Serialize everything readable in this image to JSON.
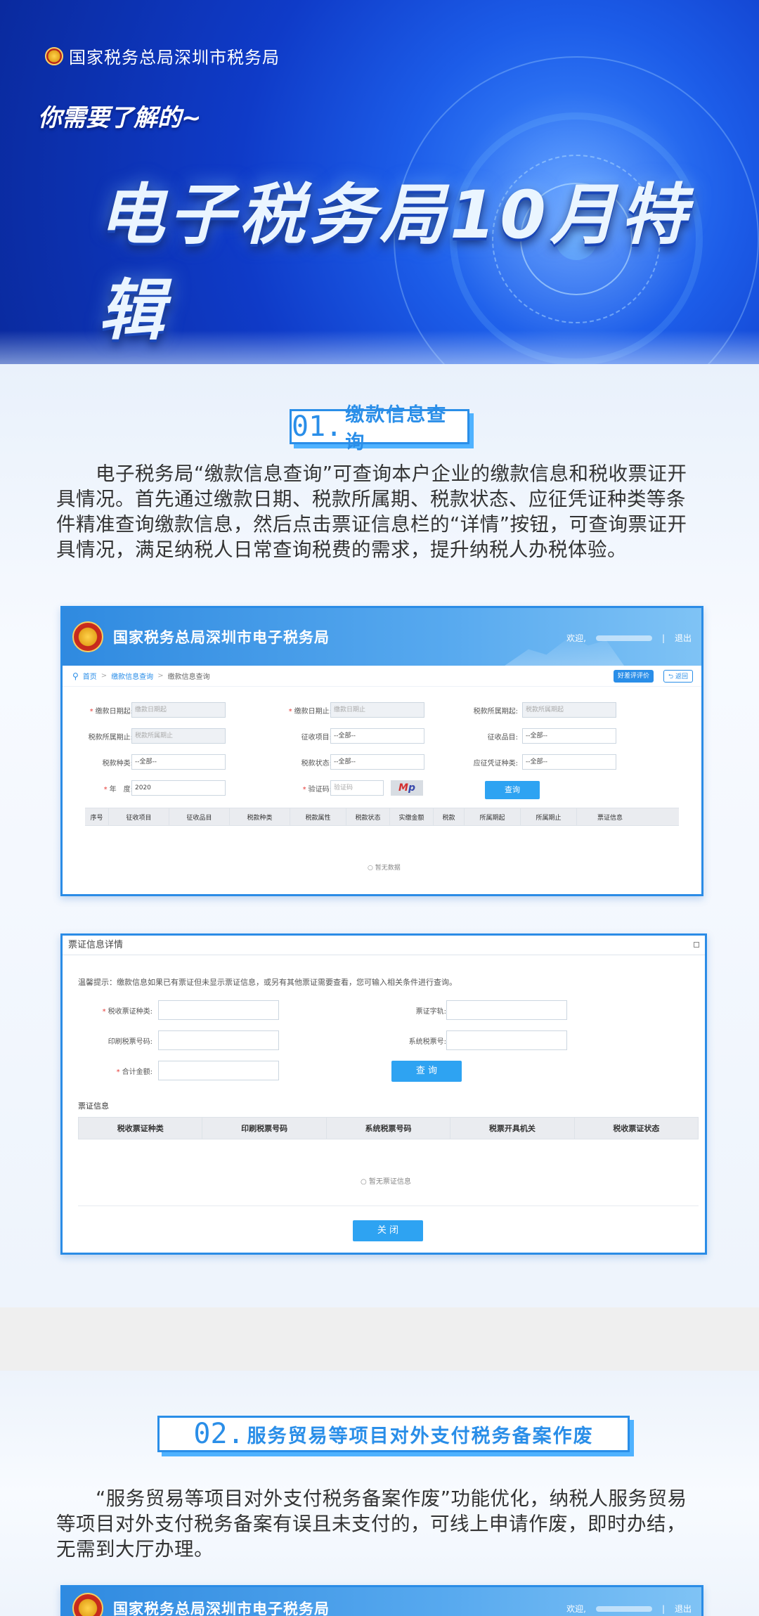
{
  "banner": {
    "org": "国家税务总局深圳市税务局",
    "subhead": "你需要了解的~",
    "title": "电子税务局10月特辑"
  },
  "section1": {
    "number": "01.",
    "heading": "缴款信息查询",
    "paragraph": "电子税务局“缴款信息查询”可查询本户企业的缴款信息和税收票证开具情况。首先通过缴款日期、税款所属期、税款状态、应征凭证种类等条件精准查询缴款信息，然后点击票证信息栏的“详情”按钮，可查询票证开具情况，满足纳税人日常查询税费的需求，提升纳税人办税体验。",
    "app": {
      "title": "国家税务总局深圳市电子税务局",
      "welcome": "欢迎,",
      "logout": "退出",
      "breadcrumb": [
        "首页",
        "缴款信息查询",
        "缴款信息查询"
      ],
      "eval_button": "好差评评价",
      "back_button": "返回",
      "form": {
        "pay_date_from_label": "缴款日期起:",
        "pay_date_from_ph": "缴款日期起",
        "pay_date_to_label": "缴款日期止:",
        "pay_date_to_ph": "缴款日期止",
        "tax_period_from_label": "税款所属期起:",
        "tax_period_from_ph": "税款所属期起",
        "tax_period_to_label": "税款所属期止:",
        "tax_period_to_ph": "税款所属期止",
        "levy_item_label": "征收项目:",
        "levy_item_value": "--全部--",
        "levy_product_label": "征收品目:",
        "levy_product_value": "--全部--",
        "tax_type_label": "税款种类:",
        "tax_type_value": "--全部--",
        "tax_status_label": "税款状态:",
        "tax_status_value": "--全部--",
        "voucher_type_label": "应征凭证种类:",
        "voucher_type_value": "--全部--",
        "year_label": "年　度:",
        "year_value": "2020",
        "captcha_label": "验证码:",
        "captcha_ph": "验证码",
        "captcha_a": "M",
        "captcha_b": "p",
        "query_button": "查询"
      },
      "table_headers": [
        "序号",
        "征收项目",
        "征收品目",
        "税款种类",
        "税款属性",
        "税款状态",
        "实缴金额",
        "税款",
        "所属期起",
        "所属期止",
        "票证信息"
      ],
      "no_data": "○ 暂无数据"
    },
    "modal": {
      "title": "票证信息详情",
      "tip": "温馨提示：缴款信息如果已有票证但未显示票证信息，或另有其他票证需要查看，您可输入相关条件进行查询。",
      "voucher_type_label": "税收票证种类:",
      "voucher_word_label": "票证字轨:",
      "print_no_label": "印刷税票号码:",
      "system_no_label": "系统税票号:",
      "total_label": "合计金额:",
      "query_button": "查 询",
      "ticket_info": "票证信息",
      "table_headers": [
        "税收票证种类",
        "印刷税票号码",
        "系统税票号码",
        "税票开具机关",
        "税收票证状态"
      ],
      "no_data": "○ 暂无票证信息",
      "close_button": "关 闭"
    }
  },
  "section2": {
    "number": "02.",
    "heading": "服务贸易等项目对外支付税务备案作废",
    "paragraph": "“服务贸易等项目对外支付税务备案作废”功能优化，纳税人服务贸易等项目对外支付税务备案有误且未支付的，可线上申请作废，即时办结，无需到大厅办理。",
    "app_title": "国家税务总局深圳市电子税务局",
    "welcome": "欢迎,",
    "logout": "退出"
  },
  "colors": {
    "accent": "#2a8ee8",
    "banner_dark": "#0a2a9e",
    "button": "#2ea3f2",
    "required": "#e53935"
  }
}
